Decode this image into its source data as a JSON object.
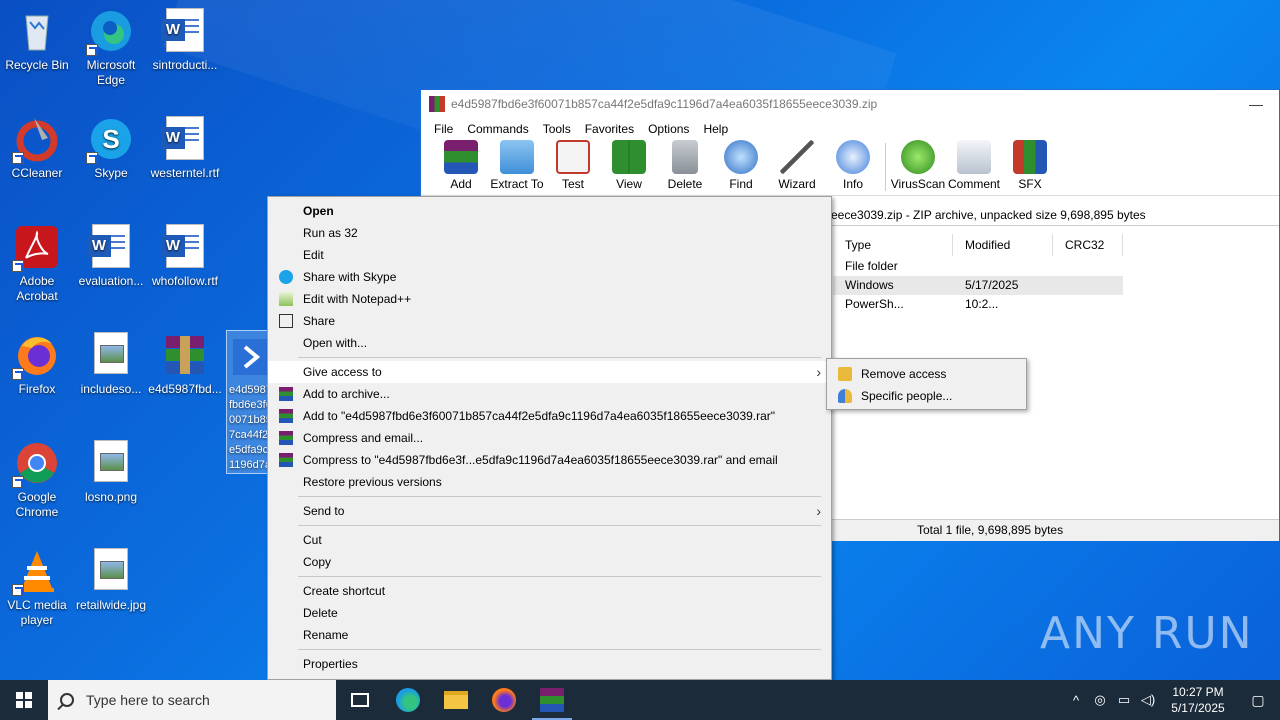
{
  "desktop": {
    "icons": [
      {
        "label": "Recycle Bin"
      },
      {
        "label": "Microsoft Edge"
      },
      {
        "label": "sintroducti..."
      },
      {
        "label": "CCleaner"
      },
      {
        "label": "Skype"
      },
      {
        "label": "westerntel.rtf"
      },
      {
        "label": "Adobe Acrobat"
      },
      {
        "label": "evaluation..."
      },
      {
        "label": "whofollow.rtf"
      },
      {
        "label": "Firefox"
      },
      {
        "label": "includeso..."
      },
      {
        "label": "e4d5987fbd..."
      },
      {
        "label": "Google Chrome"
      },
      {
        "label": "losno.png"
      },
      {
        "label": "VLC media player"
      },
      {
        "label": "retailwide.jpg"
      }
    ],
    "selected_icon_label": "e4d5987fbd6e3f60071b857ca44f2e5dfa9c1196d7a4ea6035f18655eece3039"
  },
  "winrar": {
    "title": "e4d5987fbd6e3f60071b857ca44f2e5dfa9c1196d7a4ea6035f18655eece3039.zip",
    "minimize": "—",
    "menu": [
      "File",
      "Commands",
      "Tools",
      "Favorites",
      "Options",
      "Help"
    ],
    "toolbar": [
      "Add",
      "Extract To",
      "Test",
      "View",
      "Delete",
      "Find",
      "Wizard",
      "Info",
      "VirusScan",
      "Comment",
      "SFX"
    ],
    "path_info": "eece3039.zip - ZIP archive, unpacked size 9,698,895 bytes",
    "columns": [
      "Type",
      "Modified",
      "CRC32"
    ],
    "rows": [
      {
        "type": "File folder",
        "modified": "",
        "crc": ""
      },
      {
        "type": "Windows PowerSh...",
        "modified": "5/17/2025 10:2...",
        "crc": ""
      }
    ],
    "status": "Total 1 file, 9,698,895 bytes"
  },
  "context_menu": {
    "items": [
      "Open",
      "Run as 32",
      "Edit",
      "Share with Skype",
      "Edit with Notepad++",
      "Share",
      "Open with...",
      "Give access to",
      "Add to archive...",
      "Add to \"e4d5987fbd6e3f60071b857ca44f2e5dfa9c1196d7a4ea6035f18655eece3039.rar\"",
      "Compress and email...",
      "Compress to \"e4d5987fbd6e3f...e5dfa9c1196d7a4ea6035f18655eece3039.rar\" and email",
      "Restore previous versions",
      "Send to",
      "Cut",
      "Copy",
      "Create shortcut",
      "Delete",
      "Rename",
      "Properties"
    ],
    "submenu": [
      "Remove access",
      "Specific people..."
    ]
  },
  "taskbar": {
    "search_placeholder": "Type here to search",
    "time": "10:27 PM",
    "date": "5/17/2025"
  },
  "watermark": "ANY RUN"
}
